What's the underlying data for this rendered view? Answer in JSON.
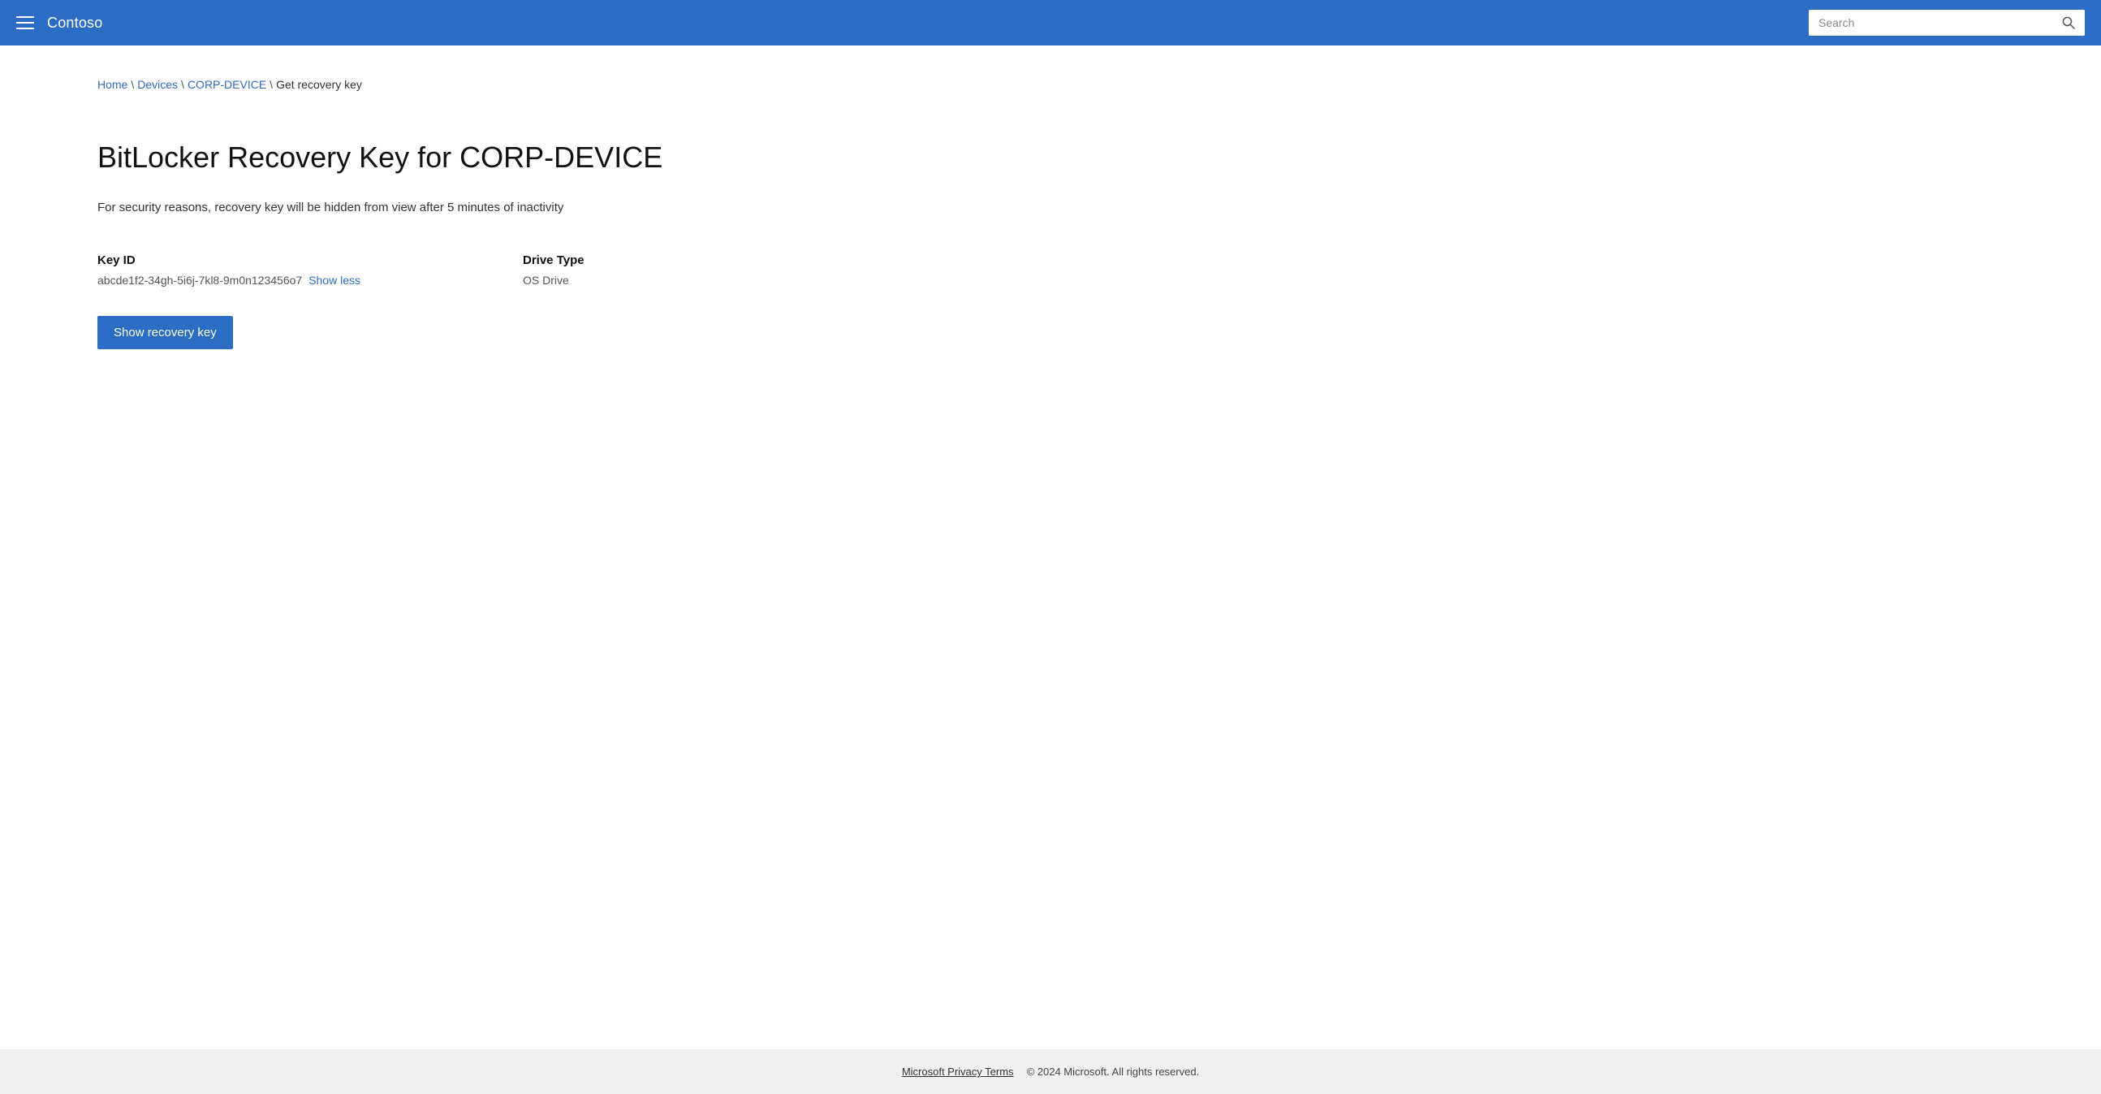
{
  "header": {
    "app_title": "Contoso",
    "search_placeholder": "Search",
    "search_icon": "🔍"
  },
  "breadcrumb": {
    "items": [
      {
        "label": "Home",
        "link": true
      },
      {
        "label": "Devices",
        "link": true
      },
      {
        "label": "CORP-DEVICE",
        "link": true
      },
      {
        "label": "Get recovery key",
        "link": false
      }
    ]
  },
  "page": {
    "title": "BitLocker Recovery Key for CORP-DEVICE",
    "security_notice": "For security reasons, recovery key will be hidden from view after 5 minutes of inactivity",
    "key_id_label": "Key ID",
    "key_id_value": "abcde1f2-34gh-5i6j-7kl8-9m0n123456o7",
    "show_less_label": "Show less",
    "drive_type_label": "Drive Type",
    "drive_type_value": "OS Drive",
    "show_recovery_key_button": "Show recovery key"
  },
  "footer": {
    "privacy_link": "Microsoft Privacy Terms",
    "copyright": "© 2024 Microsoft. All rights reserved."
  }
}
